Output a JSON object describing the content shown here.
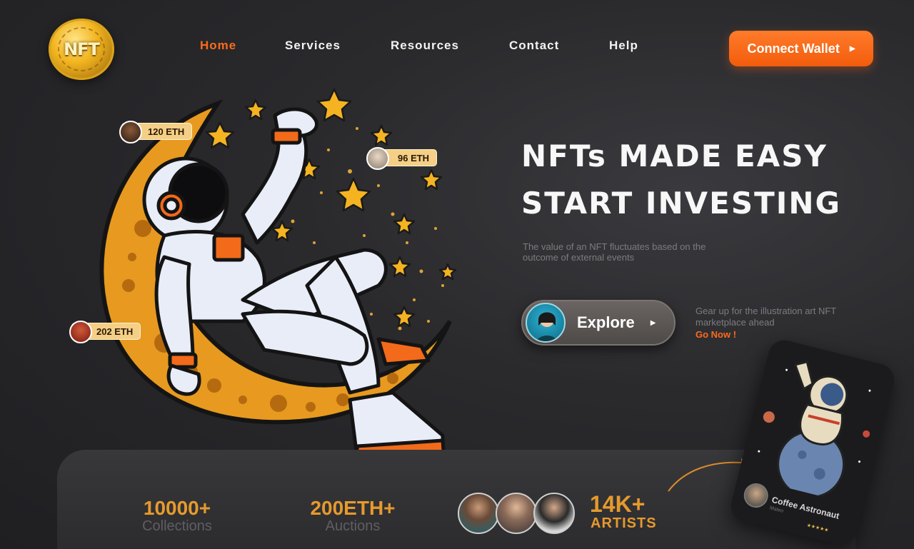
{
  "logo": {
    "text": "NFT"
  },
  "nav": {
    "items": [
      {
        "label": "Home",
        "active": true
      },
      {
        "label": "Services",
        "active": false
      },
      {
        "label": "Resources",
        "active": false
      },
      {
        "label": "Contact",
        "active": false
      },
      {
        "label": "Help",
        "active": false
      }
    ],
    "cta_label": "Connect Wallet"
  },
  "hero": {
    "headline_line1": "NFTs MADE EASY",
    "headline_line2": "START INVESTING",
    "subtext": "The value of an NFT fluctuates based on the outcome of external events",
    "explore_label": "Explore",
    "side_note": "Gear up for the illustration art NFT marketplace ahead",
    "go_now": "Go Now !",
    "price_tags": [
      "120 ETH",
      "96 ETH",
      "202 ETH"
    ]
  },
  "stats": {
    "collections_value": "10000+",
    "collections_label": "Collections",
    "auctions_value": "200ETH+",
    "auctions_label": "Auctions",
    "artists_value": "14K+",
    "artists_label": "ARTISTS"
  },
  "card": {
    "title": "Coffee Astronaut",
    "subtitle": "Mateo",
    "rating": "★★★★★"
  },
  "colors": {
    "accent": "#ff6a1a",
    "gold": "#e69a2c",
    "background": "#2a2a2d"
  }
}
